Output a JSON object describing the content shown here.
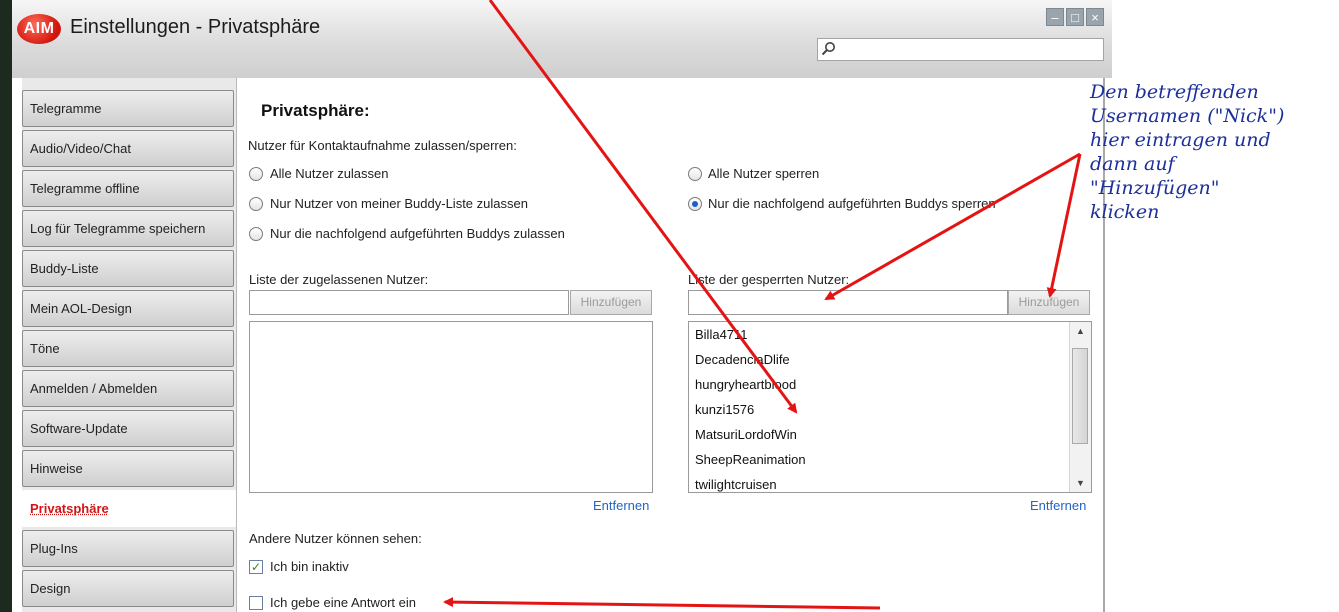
{
  "window": {
    "logo_text": "AIM",
    "title": "Einstellungen - Privatsphäre",
    "search": {
      "value": "",
      "icon": "search-icon"
    }
  },
  "sidebar": {
    "items": [
      {
        "label": "Telegramme"
      },
      {
        "label": "Audio/Video/Chat"
      },
      {
        "label": "Telegramme offline"
      },
      {
        "label": "Log für Telegramme speichern"
      },
      {
        "label": "Buddy-Liste"
      },
      {
        "label": "Mein AOL-Design"
      },
      {
        "label": "Töne"
      },
      {
        "label": "Anmelden / Abmelden"
      },
      {
        "label": "Software-Update"
      },
      {
        "label": "Hinweise"
      },
      {
        "label": "Privatsphäre",
        "active": true
      },
      {
        "label": "Plug-Ins"
      },
      {
        "label": "Design"
      }
    ]
  },
  "main": {
    "title": "Privatsphäre:",
    "contact_label": "Nutzer für Kontaktaufnahme zulassen/sperren:",
    "radios": {
      "allow_all": "Alle Nutzer zulassen",
      "allow_buddy_list": "Nur Nutzer von meiner Buddy-Liste zulassen",
      "allow_listed": "Nur die nachfolgend aufgeführten Buddys zulassen",
      "block_all": "Alle Nutzer sperren",
      "block_listed": "Nur die nachfolgend aufgeführten Buddys sperren",
      "selected": "block_listed"
    },
    "allowed": {
      "label": "Liste der zugelassenen Nutzer:",
      "input_value": "",
      "add_label": "Hinzufügen",
      "remove_label": "Entfernen",
      "items": []
    },
    "blocked": {
      "label": "Liste der gesperrten Nutzer:",
      "input_value": "",
      "add_label": "Hinzufügen",
      "remove_label": "Entfernen",
      "items": [
        "Billa4711",
        "DecadenciaDlife",
        "hungryheartblood",
        "kunzi1576",
        "MatsuriLordofWin",
        "SheepReanimation",
        "twilightcruisen"
      ]
    },
    "visibility": {
      "label": "Andere Nutzer können sehen:",
      "inactive": {
        "label": "Ich bin inaktiv",
        "checked": true
      },
      "typing": {
        "label": "Ich gebe eine Antwort ein",
        "checked": false
      }
    }
  },
  "annotation": {
    "lines": [
      "Den betreffenden",
      "Usernamen (\"Nick\")",
      "hier eintragen und",
      "dann auf",
      "\"Hinzufügen\"",
      "klicken"
    ],
    "arrow_color": "#e51414",
    "text_color": "#1c2f9a"
  }
}
